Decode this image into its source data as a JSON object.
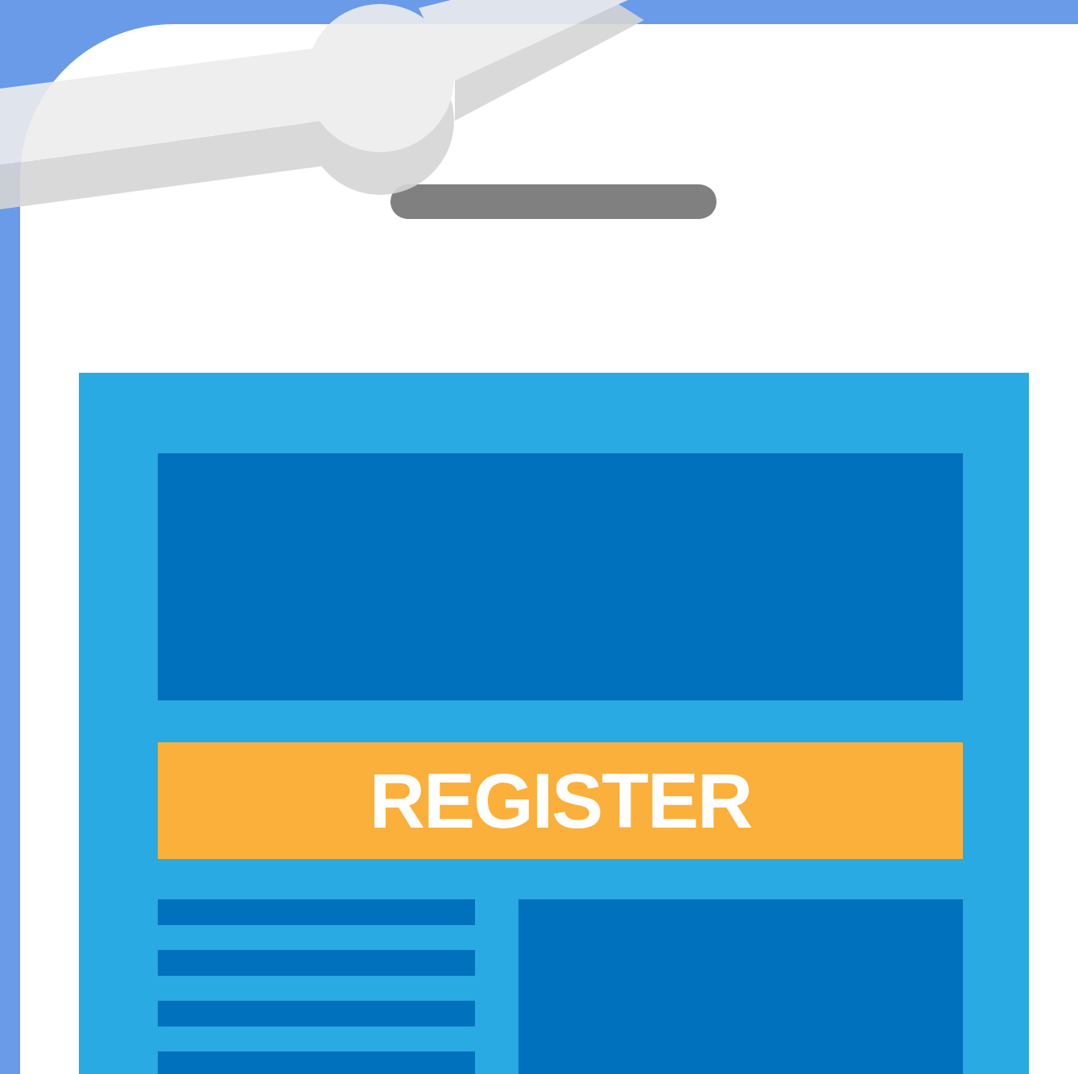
{
  "button": {
    "label": "REGISTER"
  }
}
